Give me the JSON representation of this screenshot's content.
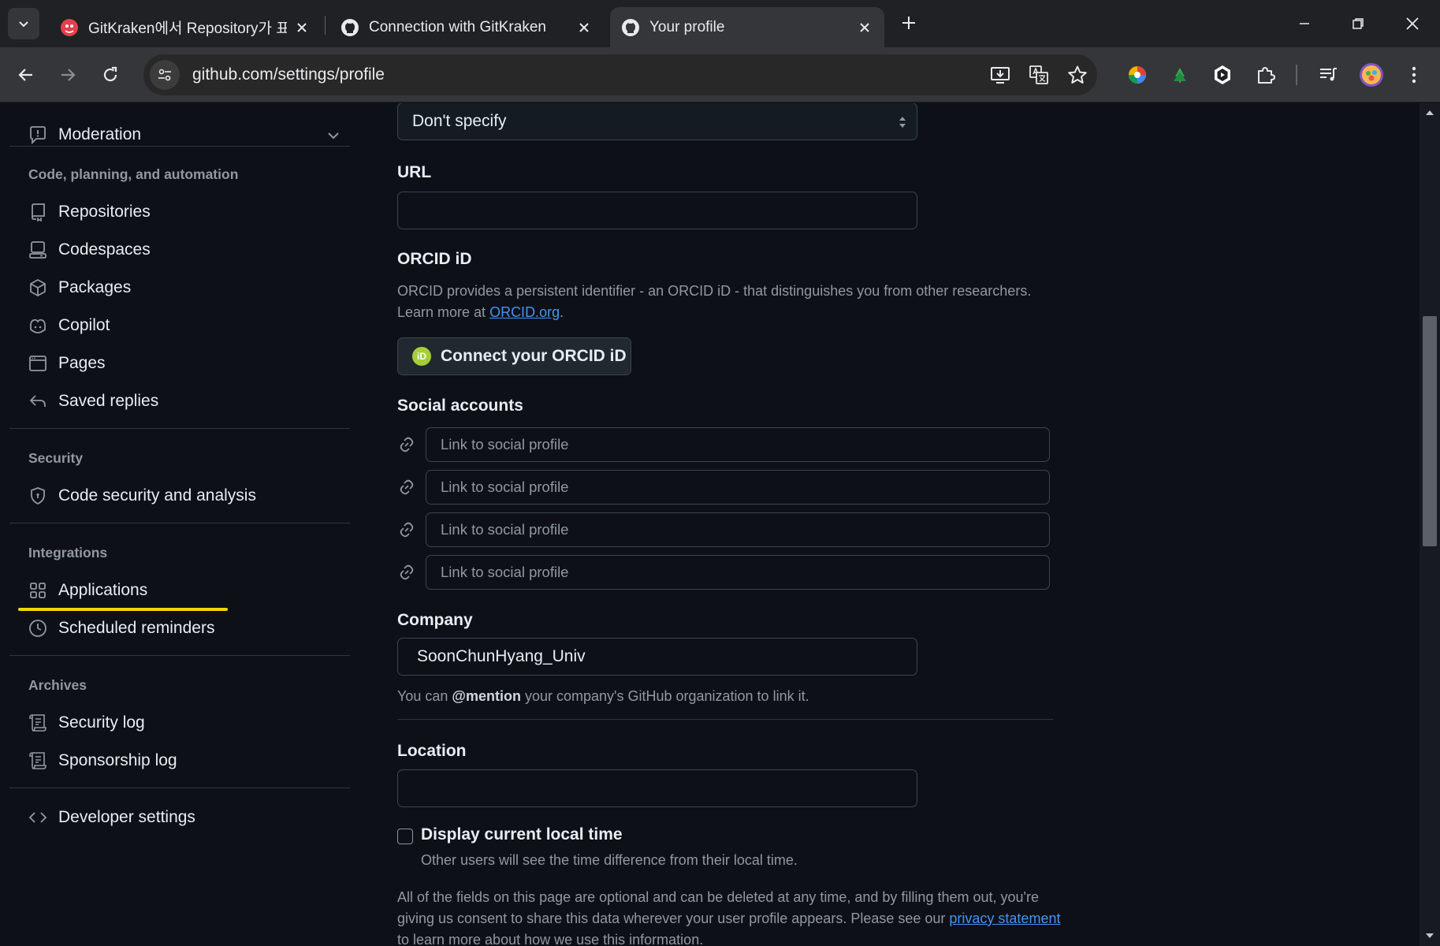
{
  "browser": {
    "tabs": [
      {
        "title": "GitKraken에서 Repository가 표",
        "active": false
      },
      {
        "title": "Connection with GitKraken",
        "active": false
      },
      {
        "title": "Your profile",
        "active": true
      }
    ],
    "url": "github.com/settings/profile"
  },
  "sidebar": {
    "moderation": "Moderation",
    "code_heading": "Code, planning, and automation",
    "code_items": [
      "Repositories",
      "Codespaces",
      "Packages",
      "Copilot",
      "Pages",
      "Saved replies"
    ],
    "security_heading": "Security",
    "security_items": [
      "Code security and analysis"
    ],
    "integrations_heading": "Integrations",
    "integration_items": [
      "Applications",
      "Scheduled reminders"
    ],
    "archives_heading": "Archives",
    "archive_items": [
      "Security log",
      "Sponsorship log"
    ],
    "developer_settings": "Developer settings"
  },
  "form": {
    "pronouns_value": "Don't specify",
    "url_label": "URL",
    "url_value": "",
    "orcid_label": "ORCID iD",
    "orcid_desc": "ORCID provides a persistent identifier - an ORCID iD - that distinguishes you from other researchers.",
    "orcid_learn_prefix": "Learn more at ",
    "orcid_link": "ORCID.org",
    "orcid_learn_suffix": ".",
    "orcid_logo_text": "iD",
    "orcid_button": "Connect your ORCID iD",
    "social_label": "Social accounts",
    "social_placeholders": [
      "Link to social profile",
      "Link to social profile",
      "Link to social profile",
      "Link to social profile"
    ],
    "company_label": "Company",
    "company_value": "SoonChunHyang_Univ",
    "company_note_prefix": "You can ",
    "company_note_mention": "@mention",
    "company_note_suffix": " your company's GitHub organization to link it.",
    "location_label": "Location",
    "location_value": "",
    "local_time_label": "Display current local time",
    "local_time_note": "Other users will see the time difference from their local time.",
    "footer_line1": "All of the fields on this page are optional and can be deleted at any time, and by filling them out, you're",
    "footer_line2_prefix": "giving us consent to share this data wherever your user profile appears. Please see our ",
    "footer_link": "privacy statement",
    "footer_line3": "to learn more about how we use this information."
  },
  "colors": {
    "page_bg": "#0d1117",
    "link": "#4493f8",
    "highlight_underline": "#f2d600",
    "orcid_green": "#a6ce39"
  }
}
